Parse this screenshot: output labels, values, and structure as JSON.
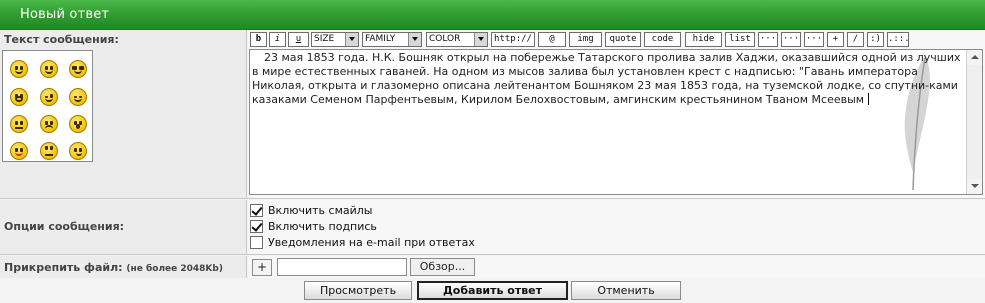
{
  "header": {
    "title": "Новый ответ"
  },
  "message": {
    "label": "Текст сообщения:",
    "text": "23 мая 1853 года. Н.К. Бошняк открыл на побережье Татарского пролива залив Хаджи, оказавшийся одной из лучших в мире естественных гаваней. На одном из мысов залива был установлен крест с надписью: \"Гавань императора Николая, открыта и глазомерно описана лейтенантом Бошняком 23 мая 1853 года, на туземской лодке, со спутни-ками казаками Семеном Парфентьевым, Кирилом Белохвостовым, амгинским крестьянином Тваном Мсеевым"
  },
  "smilies": [
    "smile",
    "grin",
    "cool",
    "crazy",
    "wink",
    "happy",
    "confused",
    "sad",
    "shocked",
    "tongue",
    "rolleyes",
    "blush"
  ],
  "toolbar": {
    "bold": "b",
    "italic": "i",
    "underline": "u",
    "size": "SIZE",
    "family": "FAMILY",
    "color": "COLOR",
    "http": "http://",
    "at": "@",
    "img": "img",
    "quote": "quote",
    "code": "code",
    "hide": "hide",
    "list": "list",
    "e1": "···",
    "e2": "···",
    "e3": "···",
    "plus": "+",
    "slash": "/",
    "smile": ":)",
    "more": ".::."
  },
  "options": {
    "label": "Опции сообщения:",
    "items": [
      {
        "label": "Включить смайлы",
        "checked": true
      },
      {
        "label": "Включить подпись",
        "checked": true
      },
      {
        "label": "Уведомления на e-mail при ответах",
        "checked": false
      }
    ]
  },
  "attach": {
    "label": "Прикрепить файл:",
    "limit": "(не более 2048Kb)",
    "add": "+",
    "browse": "Обзор..."
  },
  "actions": {
    "preview": "Просмотреть",
    "submit": "Добавить ответ",
    "cancel": "Отменить"
  }
}
